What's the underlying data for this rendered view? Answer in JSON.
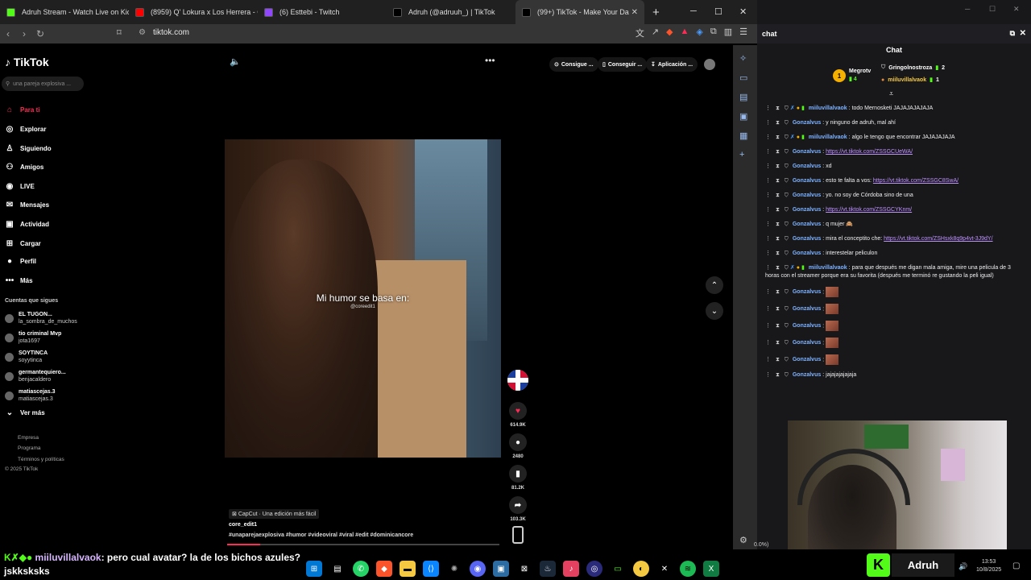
{
  "tabs": [
    {
      "label": "Adruh Stream - Watch Live on Kick",
      "color": "#53fc18",
      "active": false
    },
    {
      "label": "(8959) Q' Lokura x Los Herrera - CA",
      "color": "#ff0000",
      "active": false
    },
    {
      "label": "(6) Esttebi - Twitch",
      "color": "#9146ff",
      "active": false
    },
    {
      "label": "Adruh (@adruuh_) | TikTok",
      "color": "#000000",
      "active": false
    },
    {
      "label": "(99+) TikTok - Make Your Da",
      "color": "#000000",
      "active": true
    }
  ],
  "browser": {
    "url": "tiktok.com"
  },
  "tiktok": {
    "logo": "TikTok",
    "search_placeholder": "una pareja explosiva ...",
    "nav": [
      {
        "label": "Para ti",
        "icon": "home-icon",
        "active": true
      },
      {
        "label": "Explorar",
        "icon": "compass-icon"
      },
      {
        "label": "Siguiendo",
        "icon": "user-follow-icon"
      },
      {
        "label": "Amigos",
        "icon": "friends-icon"
      },
      {
        "label": "LIVE",
        "icon": "live-icon"
      },
      {
        "label": "Mensajes",
        "icon": "message-icon"
      },
      {
        "label": "Actividad",
        "icon": "activity-icon"
      },
      {
        "label": "Cargar",
        "icon": "upload-icon"
      },
      {
        "label": "Perfil",
        "icon": "profile-icon"
      },
      {
        "label": "Más",
        "icon": "more-icon"
      }
    ],
    "following_title": "Cuentas que sigues",
    "accounts": [
      {
        "name": "EL TUGON...",
        "handle": "la_sombra_de_muchos"
      },
      {
        "name": "tio criminal Mvp",
        "handle": "jota1697"
      },
      {
        "name": "SOYTINCA",
        "handle": "soyytinca"
      },
      {
        "name": "germantequiero...",
        "handle": "benjacaldero"
      },
      {
        "name": "matiascejas.3",
        "handle": "matiascejas.3"
      }
    ],
    "see_more": "Ver más",
    "footer": [
      "Empresa",
      "Programa",
      "Términos y políticas",
      "© 2025 TikTok"
    ],
    "top_pills": [
      "Consigue ...",
      "Conseguir ...",
      "Aplicación ..."
    ],
    "video": {
      "caption": "Mi humor se basa en:",
      "sub": "@coreedit1",
      "music": "CapCut · Una edición más fácil",
      "author": "core_edit1",
      "hashtags": "#unaparejaexplosiva #humor #videoviral #viral #edit #dominicancore",
      "progress": 0.12
    },
    "actions": [
      {
        "icon": "heart-icon",
        "count": "614.9K"
      },
      {
        "icon": "comment-icon",
        "count": "2480"
      },
      {
        "icon": "bookmark-icon",
        "count": "81.2K"
      },
      {
        "icon": "share-icon",
        "count": "103.3K"
      }
    ]
  },
  "chat": {
    "header": "chat",
    "title": "Chat",
    "leaders": [
      {
        "name": "Megrotv",
        "count": "4"
      },
      {
        "name": "Gringolnostroza",
        "count": "2"
      },
      {
        "name": "miiluvillalvaok",
        "count": "1"
      }
    ],
    "messages": [
      {
        "user": "miiluvillalvaok",
        "color": "#7fb3ff",
        "text": "todo Mernosketi JAJAJAJAJAJA",
        "link": ""
      },
      {
        "user": "Gonzalvus",
        "color": "#7fb3ff",
        "text": "y ninguno de adruh, mal ahí",
        "link": ""
      },
      {
        "user": "miiluvillalvaok",
        "color": "#7fb3ff",
        "text": "algo le tengo que encontrar JAJAJAJAJA",
        "link": ""
      },
      {
        "user": "Gonzalvus",
        "color": "#7fb3ff",
        "text": "",
        "link": "https://vt.tiktok.com/ZSSGCUeWA/"
      },
      {
        "user": "Gonzalvus",
        "color": "#7fb3ff",
        "text": "xd",
        "link": ""
      },
      {
        "user": "Gonzalvus",
        "color": "#7fb3ff",
        "text": "esto te falta a vos:",
        "link": "https://vt.tiktok.com/ZSSGC8SwA/"
      },
      {
        "user": "Gonzalvus",
        "color": "#7fb3ff",
        "text": "yo. no soy de Córdoba sino de una",
        "link": ""
      },
      {
        "user": "Gonzalvus",
        "color": "#7fb3ff",
        "text": "",
        "link": "https://vt.tiktok.com/ZSSGCYKnm/"
      },
      {
        "user": "Gonzalvus",
        "color": "#7fb3ff",
        "text": "q mujer 🙈",
        "link": ""
      },
      {
        "user": "Gonzalvus",
        "color": "#7fb3ff",
        "text": "mira el conceptito che:",
        "link": "https://vt.tiktok.com/ZSHsxk8q9p4vt-3J9dY/"
      },
      {
        "user": "Gonzalvus",
        "color": "#7fb3ff",
        "text": "interestelar peliculon",
        "link": ""
      },
      {
        "user": "miiluvillalvaok",
        "color": "#7fb3ff",
        "text": "para que después me digan mala amiga, mire una pelicula de 3 horas con el streamer porque era su favorita (después me terminó re gustando la peli igual)",
        "link": ""
      },
      {
        "user": "Gonzalvus",
        "color": "#7fb3ff",
        "text": "",
        "link": "",
        "emote": true
      },
      {
        "user": "Gonzalvus",
        "color": "#7fb3ff",
        "text": "",
        "link": "",
        "emote": true
      },
      {
        "user": "Gonzalvus",
        "color": "#7fb3ff",
        "text": "",
        "link": "",
        "emote": true
      },
      {
        "user": "Gonzalvus",
        "color": "#7fb3ff",
        "text": "",
        "link": "",
        "emote": true
      },
      {
        "user": "Gonzalvus",
        "color": "#7fb3ff",
        "text": "",
        "link": "",
        "emote": true
      },
      {
        "user": "Gonzalvus",
        "color": "#7fb3ff",
        "text": "jajajajajajaja",
        "link": ""
      }
    ]
  },
  "overlay": {
    "username": "miiluvillalvaok",
    "message": ": pero cual avatar? la de los bichos azules?",
    "line2": "jskksksks"
  },
  "taskbar": {
    "channel": "Adruh",
    "time": "13:53",
    "date": "10/8/2025",
    "status": "0.0%)"
  }
}
